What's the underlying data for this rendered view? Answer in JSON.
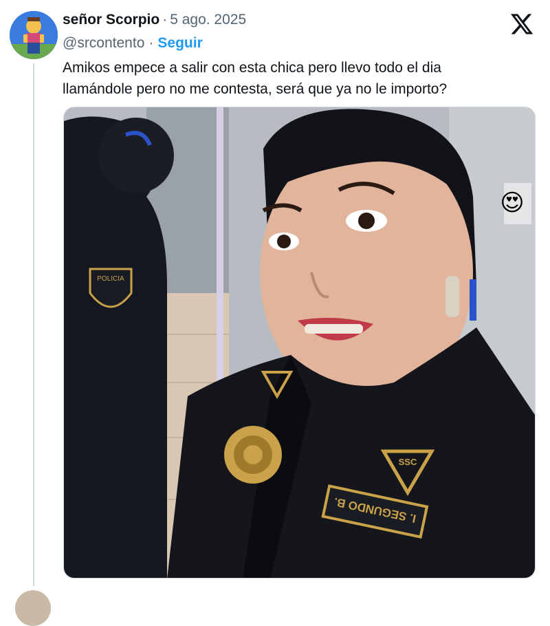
{
  "tweet": {
    "author_name": "señor Scorpio",
    "separator": "·",
    "date": "5 ago. 2025",
    "handle": "@srcontento",
    "follow_label": "Seguir",
    "text_lines": [
      "Amikos empece a salir con esta chica pero llevo todo el dia",
      "llamándole pero no me contesta, será que ya no le importo?"
    ]
  },
  "media": {
    "badge_text": "POLICIA",
    "collar_text": "SSC",
    "nametag_text": "I. SEGUNDO B.",
    "sticker_emoji": "😍"
  },
  "icons": {
    "platform_logo": "x-logo-icon"
  },
  "colors": {
    "accent": "#1d9bf0",
    "text": "#0f1419",
    "muted": "#536471",
    "border": "#cfd9de",
    "uniform": "#14161c",
    "gold": "#c9a24a"
  }
}
